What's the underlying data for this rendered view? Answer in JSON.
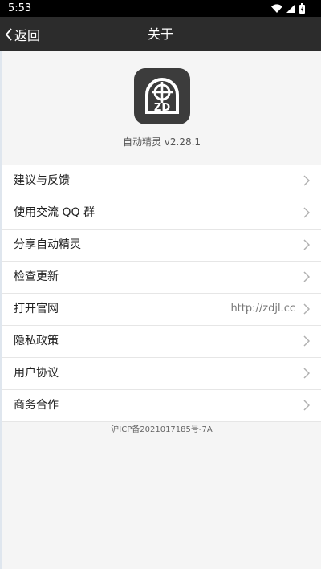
{
  "status_bar": {
    "time": "5:53",
    "icons": [
      "wifi-icon",
      "signal-icon",
      "battery-icon"
    ]
  },
  "nav": {
    "back_label": "返回",
    "title": "关于"
  },
  "app": {
    "logo_text": "ZD",
    "version_label": "自动精灵 v2.28.1"
  },
  "menu": {
    "items": [
      {
        "label": "建议与反馈",
        "value": ""
      },
      {
        "label": "使用交流 QQ 群",
        "value": ""
      },
      {
        "label": "分享自动精灵",
        "value": ""
      },
      {
        "label": "检查更新",
        "value": ""
      },
      {
        "label": "打开官网",
        "value": "http://zdjl.cc"
      },
      {
        "label": "隐私政策",
        "value": ""
      },
      {
        "label": "用户协议",
        "value": ""
      },
      {
        "label": "商务合作",
        "value": ""
      }
    ]
  },
  "footer": {
    "icp": "沪ICP备2021017185号-7A"
  },
  "colors": {
    "nav_bar": "#2c2c2c",
    "status_bar": "#000000",
    "page_background": "#f5f5f5",
    "logo_background": "#3c3c3c"
  }
}
